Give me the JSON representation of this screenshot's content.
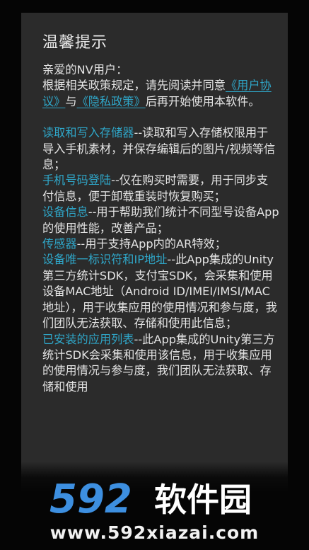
{
  "dialog": {
    "title": "温馨提示",
    "greeting": "亲爱的NV用户：",
    "intro_1": "根据相关政策规定，请先阅读并同意",
    "user_agreement_link": "《用户协议》",
    "and_text": "与",
    "privacy_link": "《隐私政策》",
    "intro_2": "后再开始使用本软件。",
    "permissions": [
      {
        "name": "读取和写入存储器",
        "desc": "--读取和写入存储权限用于导入手机素材，并保存编辑后的图片/视频等信息；"
      },
      {
        "name": "手机号码登陆",
        "desc": "--仅在购买时需要，用于同步支付信息，便于卸载重装时恢复购买；"
      },
      {
        "name": "设备信息",
        "desc": "--用于帮助我们统计不同型号设备App的使用性能，改善产品；"
      },
      {
        "name": "传感器",
        "desc": "--用于支持App内的AR特效；"
      },
      {
        "name": "设备唯一标识符和IP地址",
        "desc": "--此App集成的Unity第三方统计SDK，支付宝SDK，会采集和使用设备MAC地址（Android ID/IMEI/IMSI/MAC地址），用于收集应用的使用情况和参与度，我们团队无法获取、存储和使用此信息；"
      },
      {
        "name": "已安装的应用列表",
        "desc": "--此App集成的Unity第三方统计SDK会采集和使用该信息，用于收集应用的使用情况与参与度，我们团队无法获取、存储和使用"
      }
    ]
  },
  "watermark": {
    "logo_digits": "592",
    "logo_text": "软件园",
    "url": "www.592xiazai.com",
    "colors": {
      "digits": "#3d8fe0",
      "text": "#ffffff"
    }
  }
}
